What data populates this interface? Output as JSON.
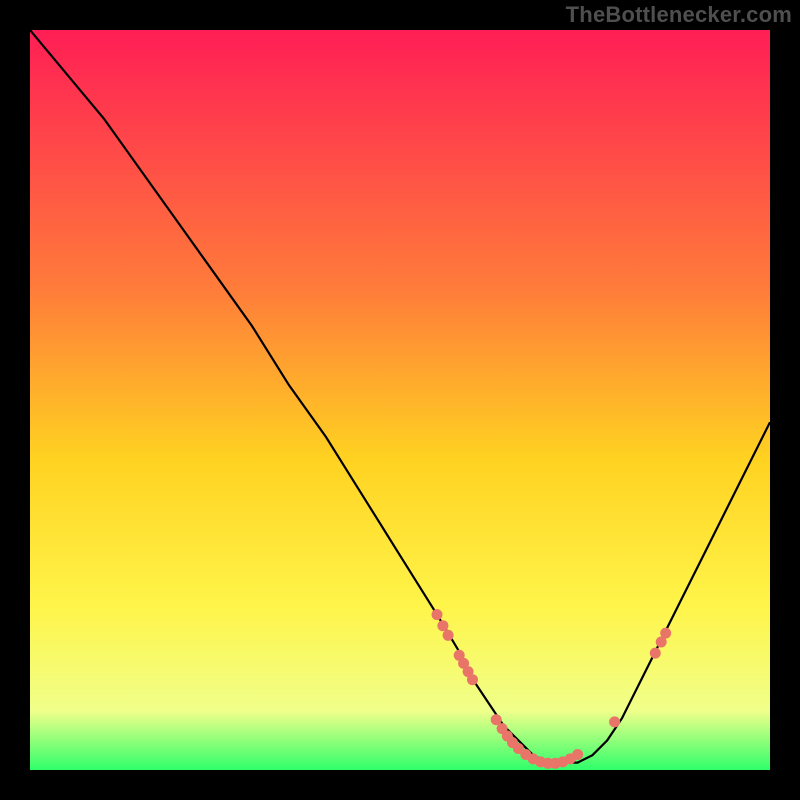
{
  "watermark": "TheBottlenecker.com",
  "colors": {
    "gradient_top": "#ff1e55",
    "gradient_mid1": "#ff7c3a",
    "gradient_mid2": "#ffd221",
    "gradient_mid3": "#fff54a",
    "gradient_mid4": "#f0ff8a",
    "gradient_bottom": "#2fff6a",
    "curve": "#000000",
    "marker": "#e97468",
    "frame": "#000000"
  },
  "chart_data": {
    "type": "line",
    "title": "",
    "xlabel": "",
    "ylabel": "",
    "xlim": [
      0,
      100
    ],
    "ylim": [
      0,
      100
    ],
    "series": [
      {
        "name": "bottleneck-curve",
        "x": [
          0,
          5,
          10,
          15,
          20,
          25,
          30,
          35,
          40,
          45,
          50,
          55,
          58,
          60,
          62,
          64,
          66,
          68,
          70,
          72,
          74,
          76,
          78,
          80,
          82,
          85,
          88,
          92,
          96,
          100
        ],
        "y": [
          100,
          94,
          88,
          81,
          74,
          67,
          60,
          52,
          45,
          37,
          29,
          21,
          16,
          12,
          9,
          6,
          4,
          2,
          1,
          1,
          1,
          2,
          4,
          7,
          11,
          17,
          23,
          31,
          39,
          47
        ]
      }
    ],
    "markers": [
      {
        "x": 55.0,
        "y": 21.0
      },
      {
        "x": 55.8,
        "y": 19.5
      },
      {
        "x": 56.5,
        "y": 18.2
      },
      {
        "x": 58.0,
        "y": 15.5
      },
      {
        "x": 58.6,
        "y": 14.4
      },
      {
        "x": 59.2,
        "y": 13.3
      },
      {
        "x": 59.8,
        "y": 12.2
      },
      {
        "x": 63.0,
        "y": 6.8
      },
      {
        "x": 63.8,
        "y": 5.6
      },
      {
        "x": 64.5,
        "y": 4.6
      },
      {
        "x": 65.2,
        "y": 3.7
      },
      {
        "x": 66.0,
        "y": 2.9
      },
      {
        "x": 67.0,
        "y": 2.1
      },
      {
        "x": 68.0,
        "y": 1.5
      },
      {
        "x": 69.0,
        "y": 1.1
      },
      {
        "x": 70.0,
        "y": 0.9
      },
      {
        "x": 71.0,
        "y": 0.9
      },
      {
        "x": 72.0,
        "y": 1.1
      },
      {
        "x": 73.0,
        "y": 1.5
      },
      {
        "x": 74.0,
        "y": 2.1
      },
      {
        "x": 79.0,
        "y": 6.5
      },
      {
        "x": 84.5,
        "y": 15.8
      },
      {
        "x": 85.3,
        "y": 17.3
      },
      {
        "x": 85.9,
        "y": 18.5
      }
    ]
  }
}
